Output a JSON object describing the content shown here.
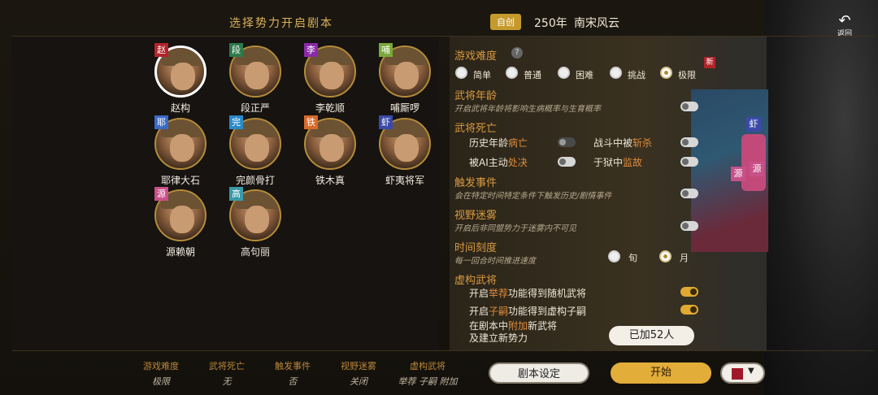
{
  "header": {
    "title": "选择势力开启剧本",
    "badge": "自创",
    "year": "250年",
    "scenario": "南宋风云",
    "back_label": "返回"
  },
  "characters": [
    {
      "tag": "赵",
      "tag_color": "#b0252a",
      "name": "赵构",
      "selected": true
    },
    {
      "tag": "段",
      "tag_color": "#2e7a4a",
      "name": "段正严"
    },
    {
      "tag": "李",
      "tag_color": "#8a2aa8",
      "name": "李乾顺"
    },
    {
      "tag": "哺",
      "tag_color": "#7aa83a",
      "name": "哺厮啰"
    },
    {
      "tag": "耶",
      "tag_color": "#3a6ac8",
      "name": "耶律大石"
    },
    {
      "tag": "完",
      "tag_color": "#2a8ac8",
      "name": "完颜骨打"
    },
    {
      "tag": "铁",
      "tag_color": "#d86a2a",
      "name": "铁木真"
    },
    {
      "tag": "虾",
      "tag_color": "#3a4aa8",
      "name": "虾夷将军"
    },
    {
      "tag": "源",
      "tag_color": "#c8508a",
      "name": "源赖朝"
    },
    {
      "tag": "高",
      "tag_color": "#3a9aa8",
      "name": "高句丽"
    }
  ],
  "settings": {
    "difficulty": {
      "title": "游戏难度",
      "help": "?",
      "new": "新",
      "options": [
        "简单",
        "普通",
        "困难",
        "挑战",
        "极限"
      ],
      "selected": "极限"
    },
    "age": {
      "title": "武将年龄",
      "desc": "开启武将年龄将影响生病概率与生育概率"
    },
    "death": {
      "title": "武将死亡",
      "hist_a": "历史年龄",
      "hist_b": "病亡",
      "battle_a": "战斗中被",
      "battle_b": "斩杀",
      "ai_a": "被AI主动",
      "ai_b": "处决",
      "prison_a": "于狱中",
      "prison_b": "监故"
    },
    "trigger": {
      "title": "触发事件",
      "desc": "会在特定时间特定条件下触发历史/剧情事件"
    },
    "fog": {
      "title": "视野迷雾",
      "desc": "开启后非同盟势力于迷雾内不可见"
    },
    "time": {
      "title": "时间刻度",
      "desc": "每一回合时间推进速度",
      "options": [
        "旬",
        "月"
      ],
      "selected": "月"
    },
    "fiction": {
      "title": "虚构武将",
      "row1_a": "开启",
      "row1_b": "举荐",
      "row1_c": "功能得到随机武将",
      "row2_a": "开启",
      "row2_b": "子嗣",
      "row2_c": "功能得到虚构子嗣",
      "row3_a": "在剧本中",
      "row3_b": "附加",
      "row3_c": "新武将",
      "row3_d": "及建立新势力",
      "added": "已加52人"
    }
  },
  "map_chips": [
    {
      "text": "虾",
      "color": "#3a4aa8"
    },
    {
      "text": "源",
      "color": "#c8508a"
    },
    {
      "text": "源",
      "color": "#c8508a"
    }
  ],
  "summary": [
    {
      "k": "游戏难度",
      "v": "极限"
    },
    {
      "k": "武将死亡",
      "v": "无"
    },
    {
      "k": "触发事件",
      "v": "否"
    },
    {
      "k": "视野迷雾",
      "v": "关闭"
    },
    {
      "k": "虚构武将",
      "v": "举荐 子嗣 附加"
    }
  ],
  "buttons": {
    "settings": "剧本设定",
    "start": "开始"
  },
  "colors": {
    "accent": "#e3ad3a",
    "faction": "#a0182a"
  }
}
